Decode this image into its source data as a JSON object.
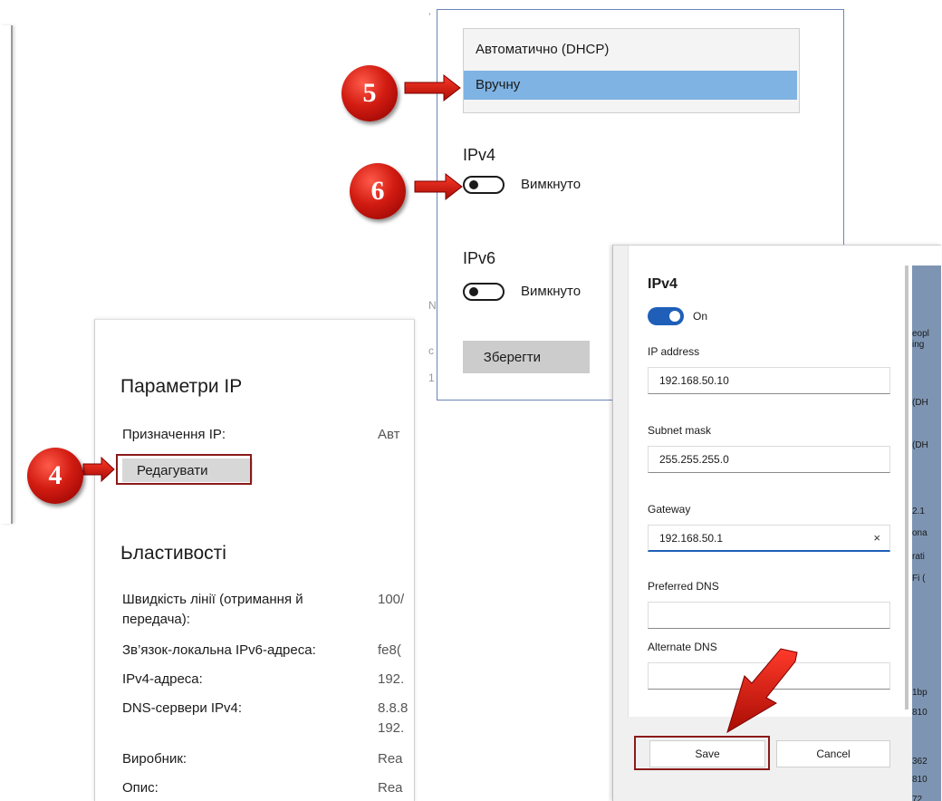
{
  "ip_panel": {
    "title": "Параметри IP",
    "assignment_label": "Призначення IP:",
    "assignment_value": "Авт",
    "edit_button": "Редагувати",
    "properties_title": "Ьластивості",
    "rows": [
      {
        "label": "Швидкість лінії (отримання й передача):",
        "value": "100/"
      },
      {
        "label": "Зв’язок-локальна IPv6-адреса:",
        "value": "fe8("
      },
      {
        "label": "IPv4-адреса:",
        "value": "192."
      },
      {
        "label": "DNS-сервери IPv4:",
        "value": "8.8.8\n192."
      },
      {
        "label": "Виробник:",
        "value": "Rea"
      },
      {
        "label": "Опис:",
        "value": "Rea"
      }
    ]
  },
  "dhcp_panel": {
    "options": [
      "Автоматично (DHCP)",
      "Вручну"
    ],
    "selected_option": "Вручну",
    "ipv4_title": "IPv4",
    "ipv4_state": "Вимкнуто",
    "ipv6_title": "IPv6",
    "ipv6_state": "Вимкнуто",
    "save_button": "Зберегти",
    "trunc_chars": [
      "ʼ",
      "N",
      "с",
      "1"
    ]
  },
  "ipv4_panel": {
    "title": "IPv4",
    "toggle_label": "On",
    "fields": {
      "ip_address": {
        "label": "IP address",
        "value": "192.168.50.10"
      },
      "subnet_mask": {
        "label": "Subnet mask",
        "value": "255.255.255.0"
      },
      "gateway": {
        "label": "Gateway",
        "value": "192.168.50.1"
      },
      "preferred_dns": {
        "label": "Preferred DNS",
        "value": ""
      },
      "alternate_dns": {
        "label": "Alternate DNS",
        "value": ""
      }
    },
    "clear_icon": "×",
    "save_button": "Save",
    "cancel_button": "Cancel",
    "strip_texts": [
      "eopl",
      "ing",
      "(DH",
      "(DH",
      "2.1",
      "ona",
      "rati",
      "Fi (",
      "1bp",
      "810",
      "362",
      "810",
      "72"
    ]
  },
  "steps": [
    "4",
    "5",
    "6"
  ],
  "colors": {
    "badge": "#d21c12",
    "arrow": "#c8180f",
    "highlight": "#8b1a1a",
    "selected": "#7fb3e3",
    "toggle_on": "#1f5fb8"
  }
}
